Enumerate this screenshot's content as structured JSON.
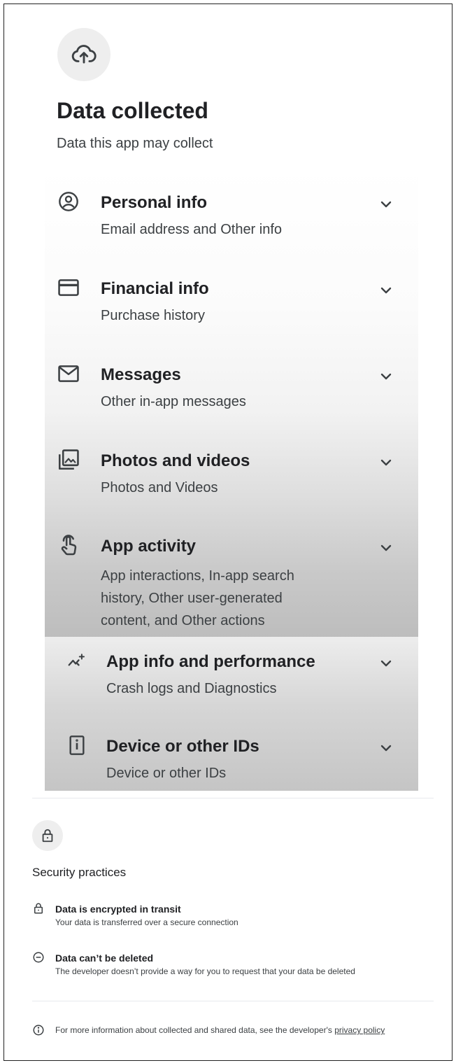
{
  "header": {
    "icon": "cloud-upload-icon",
    "title": "Data collected",
    "subtitle": "Data this app may collect"
  },
  "data_items": [
    {
      "icon": "account-circle-icon",
      "title": "Personal info",
      "description": "Email address and Other info"
    },
    {
      "icon": "credit-card-icon",
      "title": "Financial info",
      "description": "Purchase history"
    },
    {
      "icon": "mail-icon",
      "title": "Messages",
      "description": "Other in-app messages"
    },
    {
      "icon": "photo-library-icon",
      "title": "Photos and videos",
      "description": "Photos and Videos"
    },
    {
      "icon": "touch-hand-icon",
      "title": "App activity",
      "description_lines": [
        "App interactions, In-app search",
        "history, Other user-generated",
        "content, and Other actions"
      ]
    },
    {
      "icon": "performance-sparkle-icon",
      "title": "App info and performance",
      "description": "Crash logs and Diagnostics"
    },
    {
      "icon": "device-id-icon",
      "title": "Device or other IDs",
      "description": "Device or other IDs"
    }
  ],
  "security": {
    "icon": "lock-icon",
    "title": "Security practices",
    "items": [
      {
        "icon": "lock-icon",
        "title": "Data is encrypted in transit",
        "description": "Your data is transferred over a secure connection"
      },
      {
        "icon": "minus-circle-icon",
        "title": "Data can’t be deleted",
        "description": "The developer doesn’t provide a way for you to request that your data be deleted"
      }
    ]
  },
  "footer": {
    "icon": "info-icon",
    "text": "For more information about collected and shared data, see the developer's ",
    "link": "privacy policy"
  }
}
